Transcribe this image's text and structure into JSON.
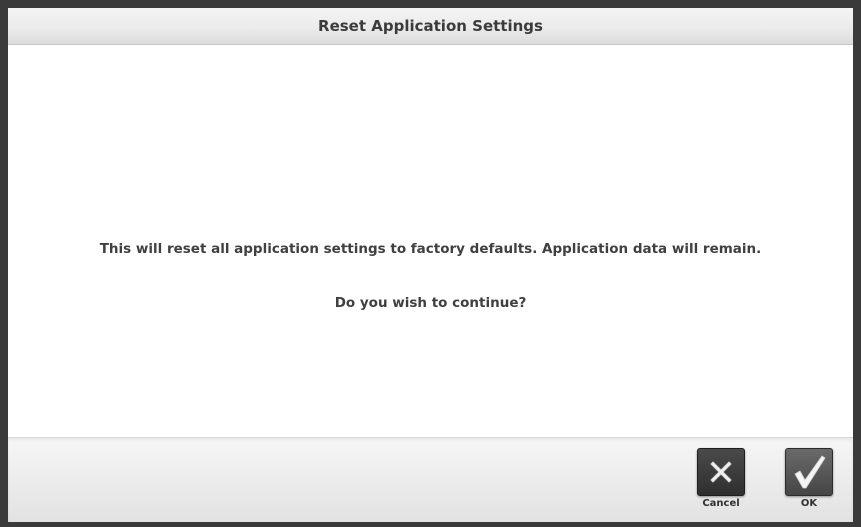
{
  "dialog": {
    "title": "Reset Application Settings",
    "message": "This will reset all application settings to factory defaults. Application data will remain.",
    "question": "Do you wish to continue?"
  },
  "buttons": {
    "cancel": {
      "label": "Cancel",
      "icon": "close-x-icon"
    },
    "ok": {
      "label": "OK",
      "icon": "checkmark-icon"
    }
  },
  "colors": {
    "frame": "#3a3a3a",
    "text": "#404040",
    "button_dark": "#333333",
    "button_gray": "#555555"
  }
}
